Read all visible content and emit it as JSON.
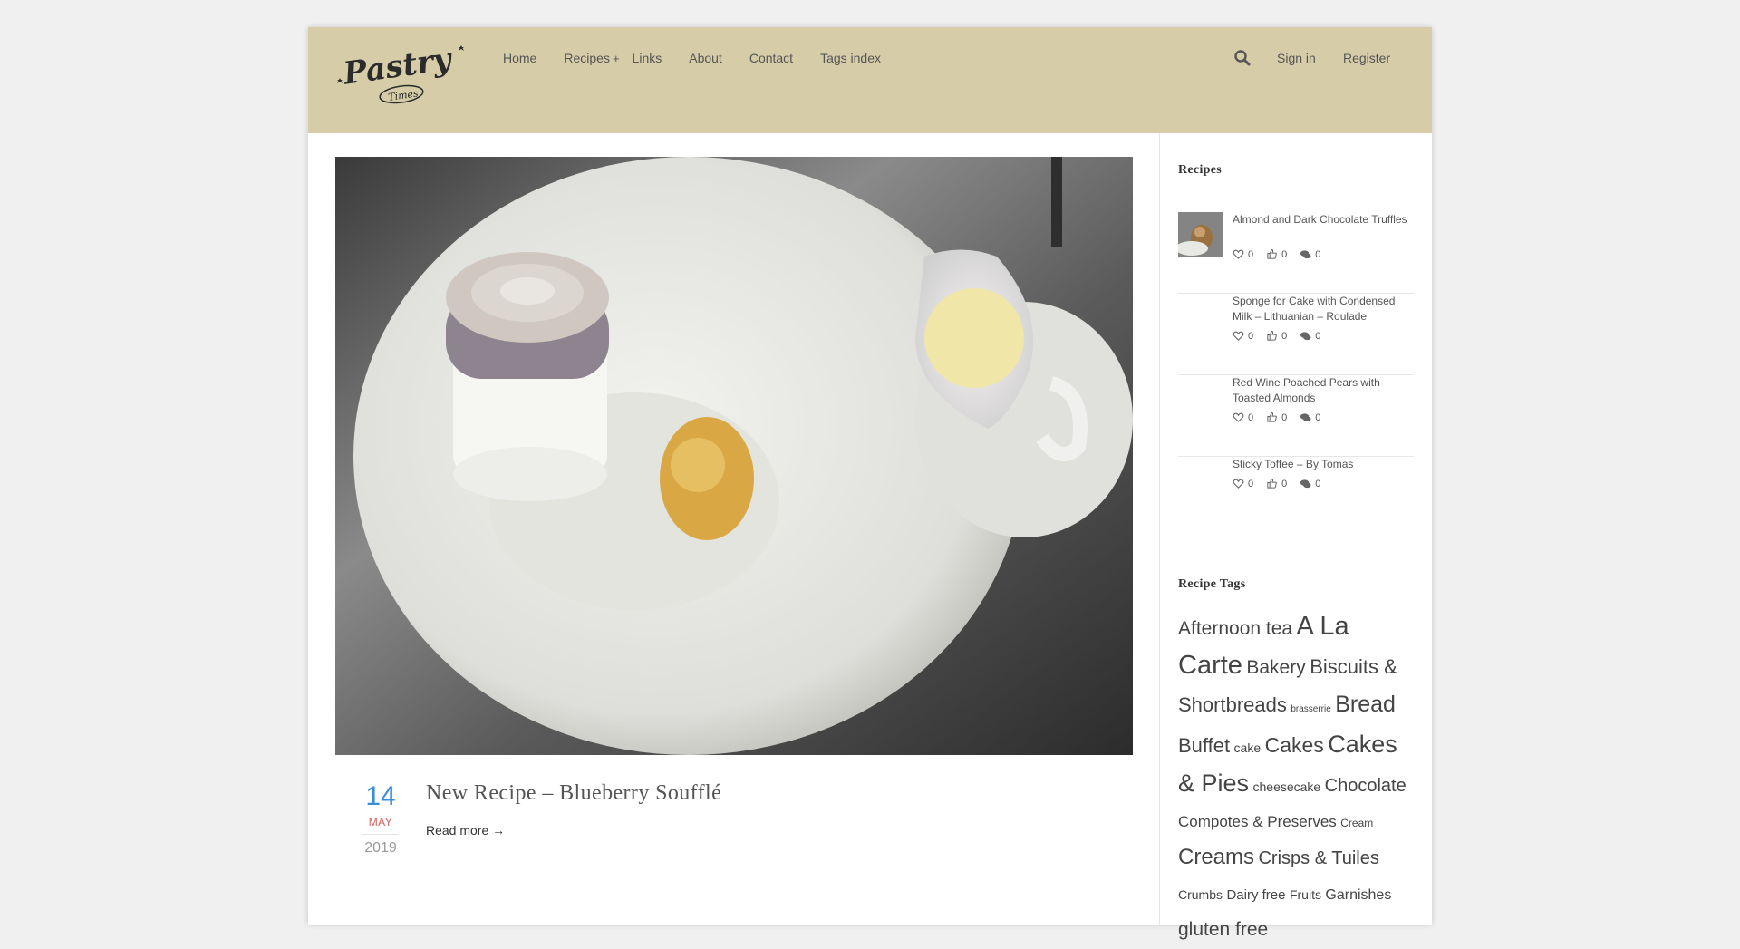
{
  "logo": {
    "text": "Pastry Times"
  },
  "nav": {
    "home": "Home",
    "recipes": "Recipes",
    "recipes_plus": "+",
    "links": "Links",
    "about": "About",
    "contact": "Contact",
    "tags_index": "Tags index"
  },
  "header_right": {
    "search_icon": "search-icon",
    "signin": "Sign in",
    "register": "Register"
  },
  "post": {
    "day": "14",
    "month": "MAY",
    "year": "2019",
    "title": "New Recipe – Blueberry Soufflé",
    "read_more": "Read more →"
  },
  "sidebar": {
    "recipes_title": "Recipes",
    "recipes": [
      {
        "title": "Almond and Dark Chocolate Truffles",
        "likes": "0",
        "thumbs": "0",
        "comments": "0"
      },
      {
        "title": "Sponge for Cake with Condensed Milk – Lithuanian – Roulade",
        "likes": "0",
        "thumbs": "0",
        "comments": "0"
      },
      {
        "title": "Red Wine Poached Pears with Toasted Almonds",
        "likes": "0",
        "thumbs": "0",
        "comments": "0"
      },
      {
        "title": "Sticky Toffee – By Tomas",
        "likes": "0",
        "thumbs": "0",
        "comments": "0"
      }
    ],
    "tags_title": "Recipe Tags",
    "tags": [
      {
        "label": "Afternoon tea"
      },
      {
        "label": "A La Carte"
      },
      {
        "label": "Bakery"
      },
      {
        "label": "Biscuits & Shortbreads"
      },
      {
        "label": "brasserrie"
      },
      {
        "label": "Bread"
      },
      {
        "label": "Buffet"
      },
      {
        "label": "cake"
      },
      {
        "label": "Cakes"
      },
      {
        "label": "Cakes & Pies"
      },
      {
        "label": "cheesecake"
      },
      {
        "label": "Chocolate"
      },
      {
        "label": "Compotes & Preserves"
      },
      {
        "label": "Cream"
      },
      {
        "label": "Creams"
      },
      {
        "label": "Crisps & Tuiles"
      },
      {
        "label": "Crumbs"
      },
      {
        "label": "Dairy free"
      },
      {
        "label": "Fruits"
      },
      {
        "label": "Garnishes"
      },
      {
        "label": "gluten free"
      }
    ]
  },
  "colors": {
    "header_bg": "#d6cca8",
    "accent_blue": "#3a8ed8",
    "month_red": "#d06060"
  }
}
